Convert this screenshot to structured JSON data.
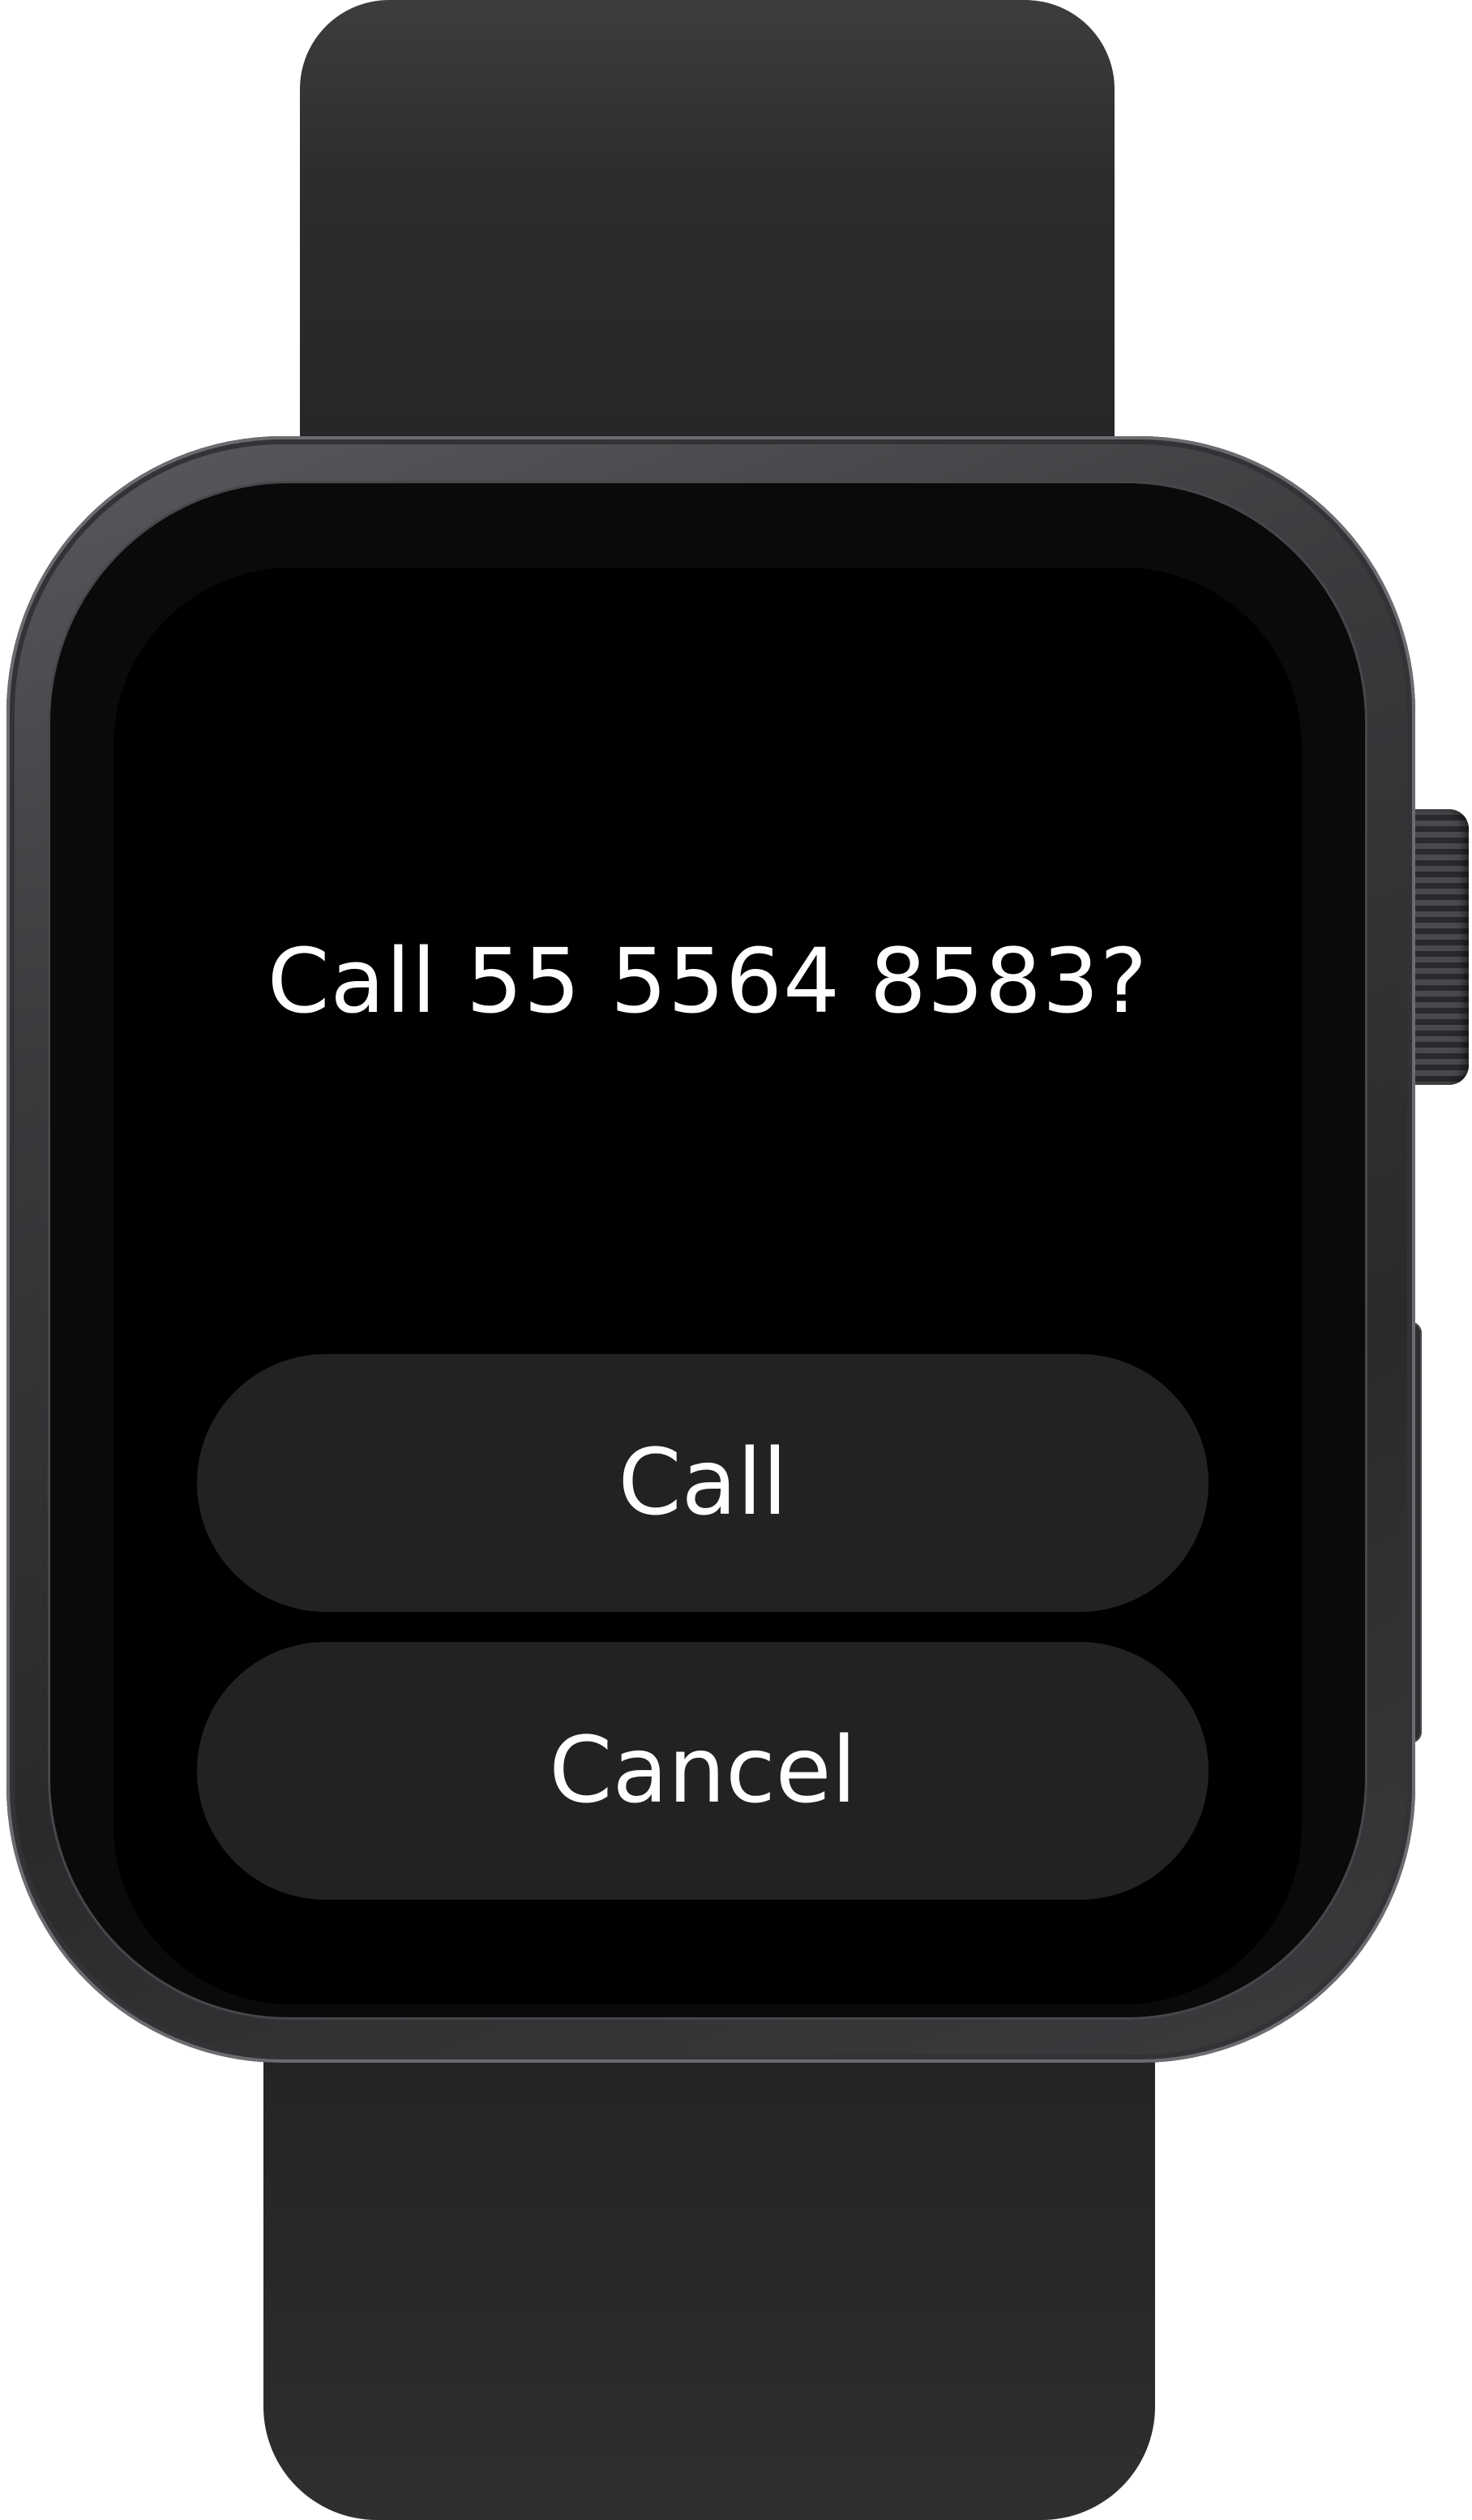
{
  "dialog": {
    "prompt": "Call 55 5564 8583?",
    "call_label": "Call",
    "cancel_label": "Cancel"
  }
}
